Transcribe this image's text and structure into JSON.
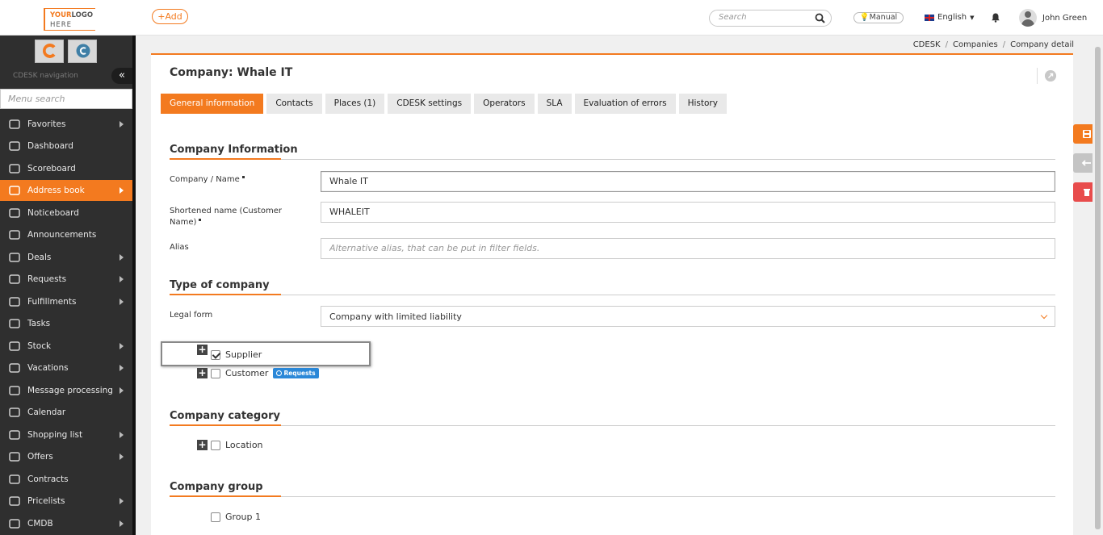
{
  "header": {
    "logo_line1_a": "YOUR",
    "logo_line1_b": "LOGO",
    "logo_line2": "HERE",
    "add_label": "+Add",
    "search_placeholder": "Search",
    "manual_label": "Manual",
    "language": "English",
    "user_name": "John Green"
  },
  "sidebar": {
    "nav_label": "CDESK navigation",
    "search_placeholder": "Menu search",
    "items": [
      {
        "label": "Favorites",
        "icon": "star-icon",
        "arrow": true
      },
      {
        "label": "Dashboard",
        "icon": "bar-chart-icon",
        "arrow": false
      },
      {
        "label": "Scoreboard",
        "icon": "line-chart-icon",
        "arrow": false
      },
      {
        "label": "Address book",
        "icon": "user-icon",
        "arrow": true,
        "active": true
      },
      {
        "label": "Noticeboard",
        "icon": "paper-plane-icon",
        "arrow": false
      },
      {
        "label": "Announcements",
        "icon": "megaphone-icon",
        "arrow": false
      },
      {
        "label": "Deals",
        "icon": "credit-card-icon",
        "arrow": true
      },
      {
        "label": "Requests",
        "icon": "check-circle-icon",
        "arrow": true
      },
      {
        "label": "Fulfillments",
        "icon": "cube-icon",
        "arrow": true
      },
      {
        "label": "Tasks",
        "icon": "list-icon",
        "arrow": false
      },
      {
        "label": "Stock",
        "icon": "box-icon",
        "arrow": true
      },
      {
        "label": "Vacations",
        "icon": "plane-icon",
        "arrow": true
      },
      {
        "label": "Message processing",
        "icon": "envelope-icon",
        "arrow": true
      },
      {
        "label": "Calendar",
        "icon": "calendar-icon",
        "arrow": false
      },
      {
        "label": "Shopping list",
        "icon": "cart-icon",
        "arrow": true
      },
      {
        "label": "Offers",
        "icon": "gift-icon",
        "arrow": true
      },
      {
        "label": "Contracts",
        "icon": "document-icon",
        "arrow": false
      },
      {
        "label": "Pricelists",
        "icon": "pricelist-icon",
        "arrow": true
      },
      {
        "label": "CMDB",
        "icon": "folder-icon",
        "arrow": true
      }
    ]
  },
  "breadcrumb": [
    "CDESK",
    "Companies",
    "Company detail"
  ],
  "page": {
    "title": "Company: Whale IT",
    "tabs": [
      "General information",
      "Contacts",
      "Places (1)",
      "CDESK settings",
      "Operators",
      "SLA",
      "Evaluation of errors",
      "History"
    ],
    "active_tab": 0
  },
  "company_info": {
    "heading": "Company Information",
    "name_label": "Company / Name",
    "name_value": "Whale IT",
    "short_label": "Shortened name (Customer Name)",
    "short_value": "WHALEIT",
    "alias_label": "Alias",
    "alias_placeholder": "Alternative alias, that can be put in filter fields."
  },
  "type_of_company": {
    "heading": "Type of company",
    "legal_label": "Legal form",
    "legal_value": "Company with limited liability",
    "supplier_label": "Supplier",
    "supplier_checked": true,
    "customer_label": "Customer",
    "customer_checked": false,
    "requests_badge": "Requests"
  },
  "company_category": {
    "heading": "Company category",
    "location_label": "Location"
  },
  "company_group": {
    "heading": "Company group",
    "group1_label": "Group 1"
  },
  "colors": {
    "accent": "#f37a1f",
    "sidebar_bg": "#2f2f2f",
    "delete": "#e84c4c",
    "badge": "#2b88d8"
  }
}
